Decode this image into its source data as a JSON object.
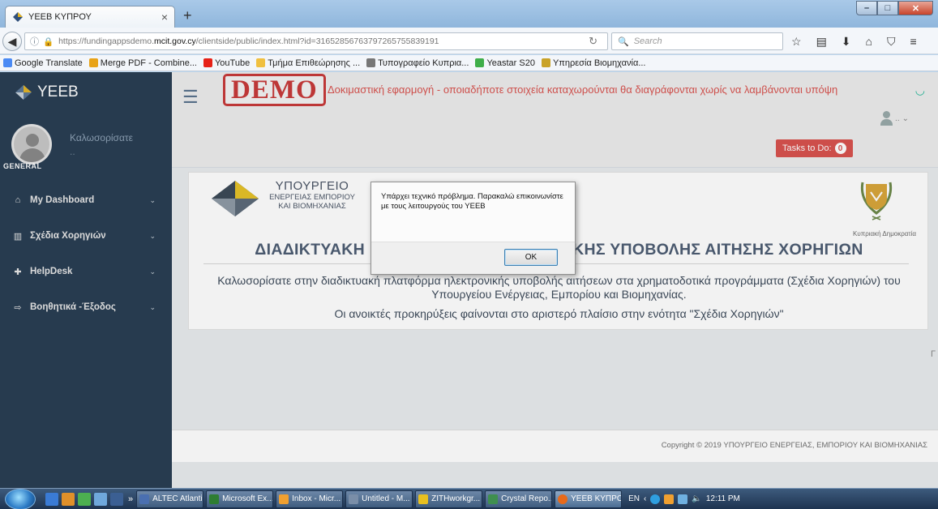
{
  "browser": {
    "tab_title": "ΥΕΕΒ ΚΥΠΡΟΥ",
    "tab_close": "×",
    "new_tab": "+",
    "url_prefix": "https://fundingappsdemo.",
    "url_domain": "mcit.gov.cy",
    "url_path": "/clientside/public/index.html?id=316528567637972657558391​91",
    "search_placeholder": "Search",
    "bookmarks": [
      {
        "label": "Google Translate",
        "color": "#4a8af4"
      },
      {
        "label": "Merge PDF - Combine...",
        "color": "#e8a317"
      },
      {
        "label": "YouTube",
        "color": "#e62117"
      },
      {
        "label": "Τμήμα Επιθεώρησης ...",
        "color": "#f0c040"
      },
      {
        "label": "Τυπογραφείο Κυπρια...",
        "color": "#777777"
      },
      {
        "label": "Yeastar S20",
        "color": "#3fae49"
      },
      {
        "label": "Υπηρεσία Βιομηχανία...",
        "color": "#c9a227"
      }
    ]
  },
  "sidebar": {
    "brand": "YEEB",
    "welcome": "Καλωσορίσατε",
    "welcome_sub": "..",
    "section": "GENERAL",
    "items": [
      {
        "label": "My Dashboard",
        "icon": "home-icon",
        "glyph": "⌂"
      },
      {
        "label": "Σχέδια Χορηγιών",
        "icon": "bank-icon",
        "glyph": "▥"
      },
      {
        "label": "HelpDesk",
        "icon": "plus-circle-icon",
        "glyph": "✚"
      },
      {
        "label": "Βοηθητικά -Έξοδος",
        "icon": "sign-out-icon",
        "glyph": "⇨"
      }
    ]
  },
  "topnav": {
    "demo_badge": "DEMO",
    "demo_notice": "Δοκιμαστική εφαρμογή - οποιαδήποτε στοιχεία καταχωρούνται θα διαγράφονται χωρίς να λαμβάνονται υπόψη",
    "user_menu": "..",
    "tasks_label": "Tasks to Do:",
    "tasks_count": "0"
  },
  "panel": {
    "ministry_line1": "ΥΠΟΥΡΓΕΙΟ",
    "ministry_line2": "ΕΝΕΡΓΕΙΑΣ ΕΜΠΟΡΙΟΥ",
    "ministry_line3": "ΚΑΙ ΒΙΟΜΗΧΑΝΙΑΣ",
    "republic": "Κυπριακή Δημοκρατία",
    "title": "ΔΙΑΔΙΚΤΥΑΚΗ ΠΛΑΤΦΟΡΜΑ ΗΛΕΚΤΡΟΝΙΚΗΣ ΥΠΟΒΟΛΗΣ ΑΙΤΗΣΗΣ ΧΟΡΗΓΙΩΝ",
    "intro": "Καλωσορίσατε στην διαδικτυακή πλατφόρμα ηλεκτρονικής υποβολής αιτήσεων στα χρηματοδοτικά προγράμματα (Σχέδια Χορηγιών) του Υπουργείου Ενέργειας, Εμπορίου και Βιομηχανίας.",
    "intro2": "Οι ανοικτές προκηρύξεις φαίνονται στο αριστερό πλαίσιο στην ενότητα \"Σχέδια Χορηγιών\""
  },
  "footer": {
    "copyright": "Copyright © 2019 ΥΠΟΥΡΓΕΙΟ ΕΝΕΡΓΕΙΑΣ, ΕΜΠΟΡΙΟΥ ΚΑΙ ΒΙΟΜΗΧΑΝΙΑΣ"
  },
  "dialog": {
    "message": "Υπάρχει τεχνικό πρόβλημα. Παρακαλώ επικοινωνίστε με τους λειτουργούς του ΥΕΕΒ",
    "ok_label": "OK"
  },
  "taskbar": {
    "items": [
      {
        "label": "ALTEC Atlantis",
        "color": "#4a6fb0"
      },
      {
        "label": "Microsoft Ex...",
        "color": "#2e7d32"
      },
      {
        "label": "Inbox - Micr...",
        "color": "#f0a030"
      },
      {
        "label": "Untitled - M...",
        "color": "#7a8ea8"
      },
      {
        "label": "ZITHworkgr...",
        "color": "#e8c020"
      },
      {
        "label": "Crystal Repo...",
        "color": "#3f8f4f"
      },
      {
        "label": "ΥΕΕΒ ΚΥΠΡΟ...",
        "color": "#e86a1a"
      }
    ],
    "language": "EN",
    "clock": "12:11 PM"
  },
  "colors": {
    "sidebar_bg": "#2a3f54",
    "demo_red": "#c83a3a",
    "tasks_red": "#d9534f"
  }
}
